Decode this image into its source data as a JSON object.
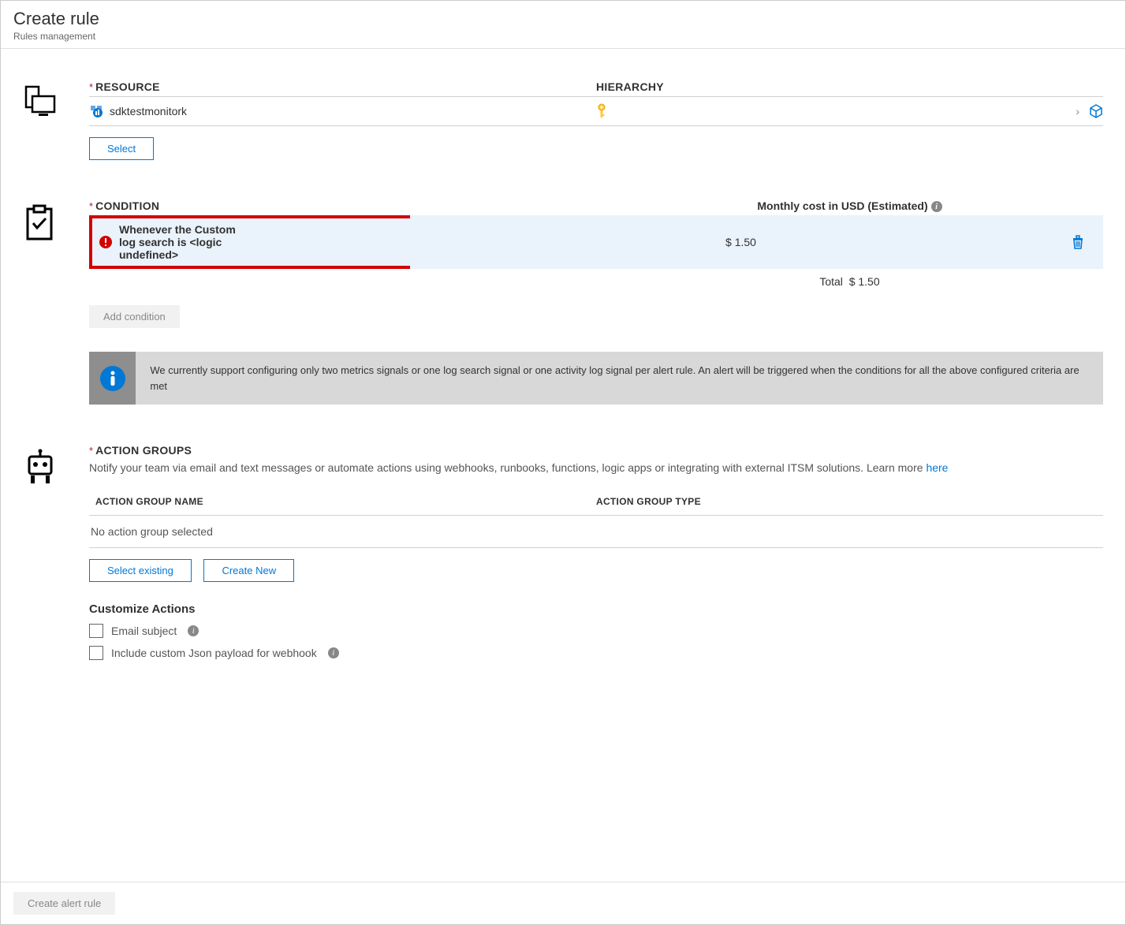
{
  "header": {
    "title": "Create rule",
    "subtitle": "Rules management"
  },
  "resource": {
    "label": "RESOURCE",
    "hierarchy_label": "HIERARCHY",
    "name": "sdktestmonitork",
    "select_button": "Select"
  },
  "condition": {
    "label": "CONDITION",
    "cost_label": "Monthly cost in USD (Estimated)",
    "item_text": "Whenever the Custom log search is <logic undefined>",
    "item_cost": "$ 1.50",
    "total_label": "Total",
    "total_cost": "$ 1.50",
    "add_button": "Add condition",
    "banner": "We currently support configuring only two metrics signals or one log search signal or one activity log signal per alert rule. An alert will be triggered when the conditions for all the above configured criteria are met"
  },
  "action_groups": {
    "label": "ACTION GROUPS",
    "description": "Notify your team via email and text messages or automate actions using webhooks, runbooks, functions, logic apps or integrating with external ITSM solutions. Learn more ",
    "learn_more": "here",
    "col_name": "ACTION GROUP NAME",
    "col_type": "ACTION GROUP TYPE",
    "no_data": "No action group selected",
    "select_existing": "Select existing",
    "create_new": "Create New",
    "customize_title": "Customize Actions",
    "email_subject": "Email subject",
    "include_json": "Include custom Json payload for webhook"
  },
  "footer": {
    "create_button": "Create alert rule"
  }
}
